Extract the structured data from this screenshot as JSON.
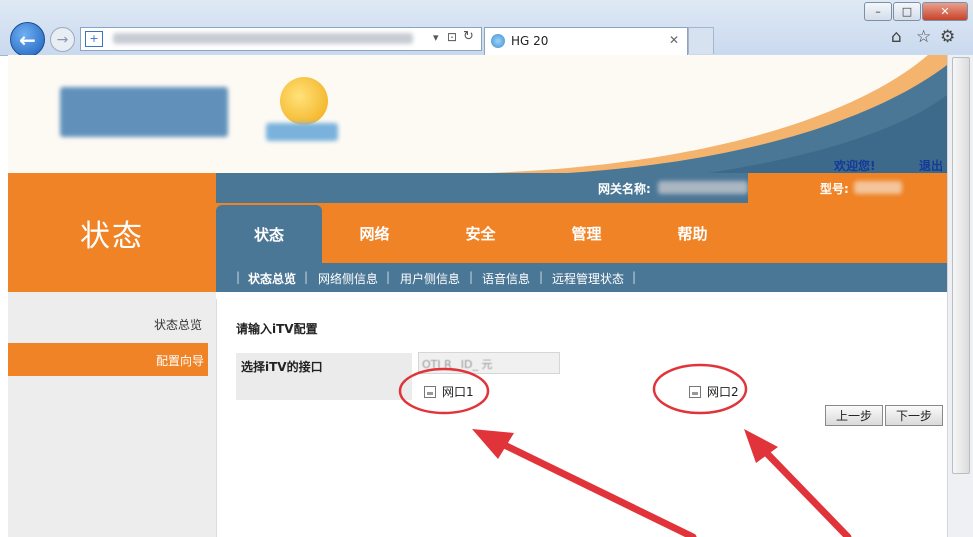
{
  "browser": {
    "tab_title": "HG 20",
    "icons": [
      "back-icon",
      "forward-icon",
      "security-icon",
      "refresh-icon",
      "home-icon",
      "favorites-star-icon",
      "gear-icon",
      "minimize-icon",
      "maximize-icon",
      "close-icon"
    ]
  },
  "header": {
    "welcome": "欢迎您!",
    "logout": "退出",
    "gateway_label": "网关名称:",
    "model_label": "型号:"
  },
  "side": {
    "section_title": "状态",
    "menu": [
      "状态总览",
      "配置向导"
    ],
    "active_index": 1
  },
  "main_tabs": [
    "状态",
    "网络",
    "安全",
    "管理",
    "帮助"
  ],
  "sub_tabs": [
    "状态总览",
    "网络侧信息",
    "用户侧信息",
    "语音信息",
    "远程管理状态"
  ],
  "content": {
    "heading": "请输入iTV配置",
    "select_label": "选择iTV的接口",
    "partial_value": "OTI R_ ID_ 元",
    "port1": "网口1",
    "port2": "网口2",
    "prev_button": "上一步",
    "next_button": "下一步"
  },
  "colors": {
    "orange": "#ef8326",
    "steel_blue": "#4b7796",
    "annotation_red": "#e0343a"
  }
}
